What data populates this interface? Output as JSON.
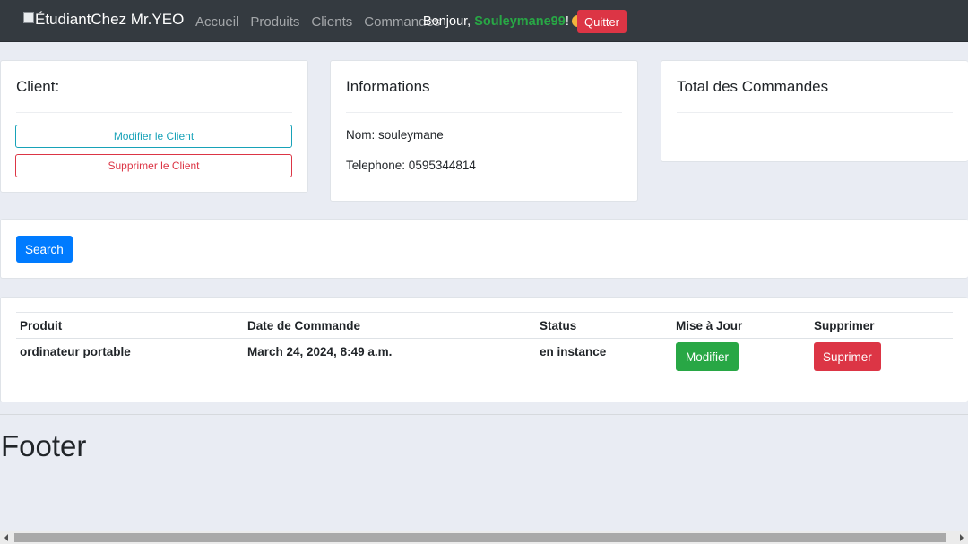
{
  "navbar": {
    "brand": "ÉtudiantChez Mr.YEO",
    "links": [
      "Accueil",
      "Produits",
      "Clients",
      "Commandes"
    ],
    "greeting_prefix": "Bonjour, ",
    "username": "Souleymane99",
    "greeting_suffix": "!",
    "quit_label": "Quitter"
  },
  "client_card": {
    "title": "Client:",
    "edit_label": "Modifier le Client",
    "delete_label": "Supprimer le Client"
  },
  "info_card": {
    "title": "Informations",
    "name_line": "Nom: souleymane",
    "phone_line": "Telephone: 0595344814"
  },
  "total_card": {
    "title": "Total des Commandes"
  },
  "search": {
    "button_label": "Search"
  },
  "orders_table": {
    "headers": [
      "Produit",
      "Date de Commande",
      "Status",
      "Mise à Jour",
      "Supprimer"
    ],
    "rows": [
      {
        "product": "ordinateur portable",
        "date": "March 24, 2024, 8:49 a.m.",
        "status": "en instance",
        "update_label": "Modifier",
        "delete_label": "Suprimer"
      }
    ]
  },
  "footer": {
    "text": "Footer"
  },
  "colors": {
    "navbar_bg": "#343a40",
    "primary": "#007bff",
    "success": "#28a745",
    "danger": "#dc3545",
    "info": "#17a2b8",
    "page_bg": "#e9ecf3"
  }
}
